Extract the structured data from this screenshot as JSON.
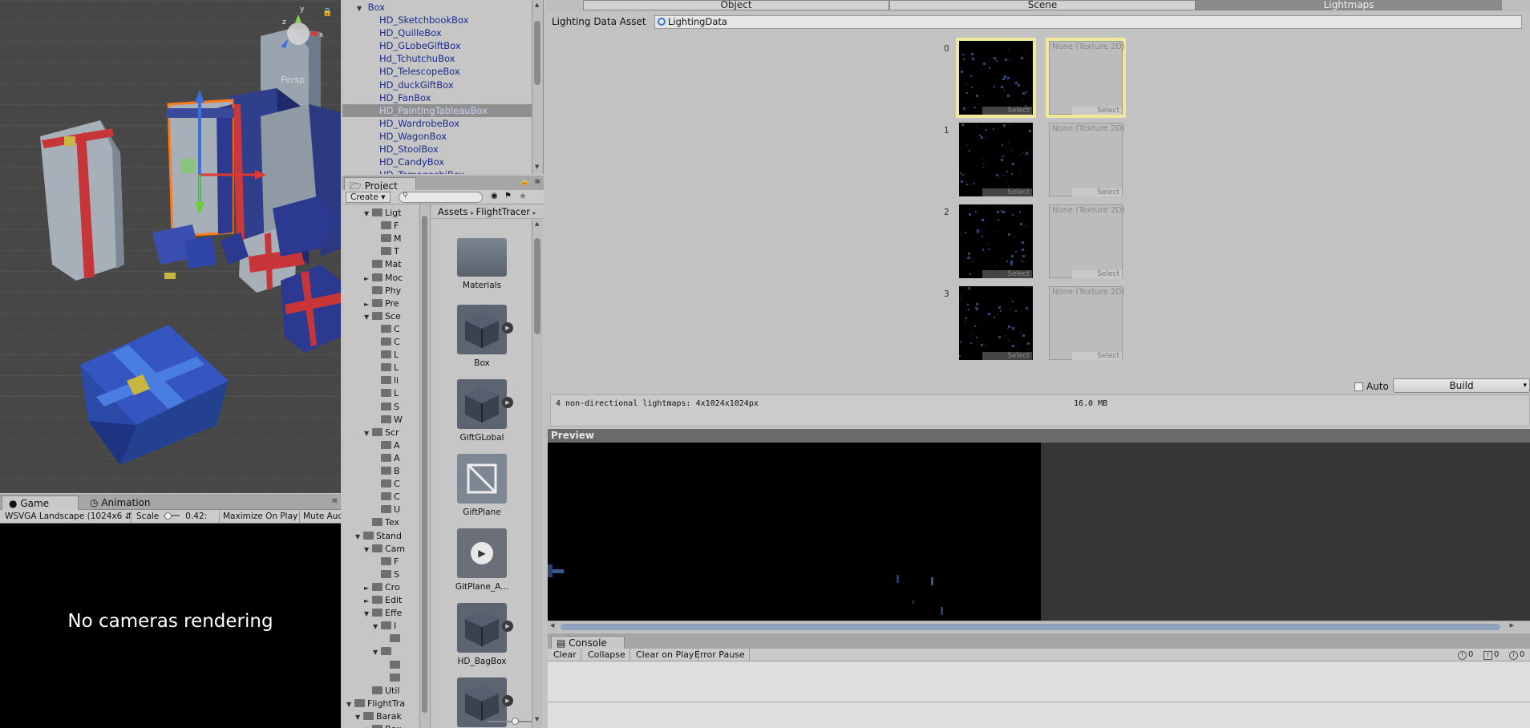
{
  "scene": {
    "persp_label": "Persp"
  },
  "game": {
    "tabs": [
      {
        "label": "Game",
        "icon": "game-icon"
      },
      {
        "label": "Animation",
        "icon": "clock-icon"
      }
    ],
    "aspect_select": "WSVGA Landscape (1024x6",
    "scale_label": "Scale",
    "scale_value": "0.42:",
    "maximize_on_play": "Maximize On Play",
    "mute_audio": "Mute Aud",
    "no_camera_text": "No cameras rendering"
  },
  "hierarchy": {
    "parent": "Box",
    "items": [
      "HD_SketchbookBox",
      "HD_QuilleBox",
      "HD_GLobeGiftBox",
      "Hd_TchutchuBox",
      "HD_TelescopeBox",
      "HD_duckGiftBox",
      "HD_FanBox",
      "HD_PaintingTableauBox",
      "HD_WardrobeBox",
      "HD_WagonBox",
      "HD_StoolBox",
      "HD_CandyBox",
      "HD_TamagochiBox"
    ],
    "selected_index": 7
  },
  "project": {
    "tab_label": "Project",
    "create_label": "Create",
    "breadcrumb": [
      "Assets",
      "FlightTracer"
    ],
    "tree": [
      {
        "label": "Ligt",
        "indent": 3,
        "arrow": "▼"
      },
      {
        "label": "F",
        "indent": 4,
        "arrow": ""
      },
      {
        "label": "M",
        "indent": 4,
        "arrow": ""
      },
      {
        "label": "T",
        "indent": 4,
        "arrow": ""
      },
      {
        "label": "Mat",
        "indent": 3,
        "arrow": ""
      },
      {
        "label": "Moc",
        "indent": 3,
        "arrow": "►"
      },
      {
        "label": "Phy",
        "indent": 3,
        "arrow": ""
      },
      {
        "label": "Pre",
        "indent": 3,
        "arrow": "►"
      },
      {
        "label": "Sce",
        "indent": 3,
        "arrow": "▼"
      },
      {
        "label": "C",
        "indent": 4,
        "arrow": ""
      },
      {
        "label": "C",
        "indent": 4,
        "arrow": ""
      },
      {
        "label": "L",
        "indent": 4,
        "arrow": ""
      },
      {
        "label": "L",
        "indent": 4,
        "arrow": ""
      },
      {
        "label": "li",
        "indent": 4,
        "arrow": ""
      },
      {
        "label": "L",
        "indent": 4,
        "arrow": ""
      },
      {
        "label": "S",
        "indent": 4,
        "arrow": ""
      },
      {
        "label": "W",
        "indent": 4,
        "arrow": ""
      },
      {
        "label": "Scr",
        "indent": 3,
        "arrow": "▼"
      },
      {
        "label": "A",
        "indent": 4,
        "arrow": ""
      },
      {
        "label": "A",
        "indent": 4,
        "arrow": ""
      },
      {
        "label": "B",
        "indent": 4,
        "arrow": ""
      },
      {
        "label": "C",
        "indent": 4,
        "arrow": ""
      },
      {
        "label": "C",
        "indent": 4,
        "arrow": ""
      },
      {
        "label": "U",
        "indent": 4,
        "arrow": ""
      },
      {
        "label": "Tex",
        "indent": 3,
        "arrow": ""
      },
      {
        "label": "Stand",
        "indent": 2,
        "arrow": "▼"
      },
      {
        "label": "Cam",
        "indent": 3,
        "arrow": "▼"
      },
      {
        "label": "F",
        "indent": 4,
        "arrow": ""
      },
      {
        "label": "S",
        "indent": 4,
        "arrow": ""
      },
      {
        "label": "Cro",
        "indent": 3,
        "arrow": "►"
      },
      {
        "label": "Edit",
        "indent": 3,
        "arrow": "►"
      },
      {
        "label": "Effe",
        "indent": 3,
        "arrow": "▼"
      },
      {
        "label": "I",
        "indent": 4,
        "arrow": "▼"
      },
      {
        "label": "",
        "indent": 5,
        "arrow": ""
      },
      {
        "label": "",
        "indent": 4,
        "arrow": "▼"
      },
      {
        "label": "",
        "indent": 5,
        "arrow": ""
      },
      {
        "label": "",
        "indent": 5,
        "arrow": ""
      },
      {
        "label": "Util",
        "indent": 3,
        "arrow": ""
      },
      {
        "label": "FlightTra",
        "indent": 1,
        "arrow": "▼"
      },
      {
        "label": "Barak",
        "indent": 2,
        "arrow": "▼"
      },
      {
        "label": "Box",
        "indent": 3,
        "arrow": "▼"
      }
    ],
    "assets": [
      {
        "name": "Materials",
        "kind": "folder"
      },
      {
        "name": "Box",
        "kind": "model"
      },
      {
        "name": "GiftGLobal",
        "kind": "model"
      },
      {
        "name": "GiftPlane",
        "kind": "mesh"
      },
      {
        "name": "GitPlane_A...",
        "kind": "anim"
      },
      {
        "name": "HD_BagBox",
        "kind": "model"
      },
      {
        "name": "",
        "kind": "model"
      }
    ]
  },
  "lightmaps": {
    "tabs": [
      "Object",
      "Scene",
      "Lightmaps"
    ],
    "active_tab": 2,
    "lighting_data_label": "Lighting Data Asset",
    "lighting_data_value": "LightingData",
    "slots": [
      {
        "index": "0",
        "select": "Select",
        "none_label": "None (Texture 2D)",
        "highlighted": true
      },
      {
        "index": "1",
        "select": "Select",
        "none_label": "None (Texture 2D)",
        "highlighted": false
      },
      {
        "index": "2",
        "select": "Select",
        "none_label": "None (Texture 2D)",
        "highlighted": false
      },
      {
        "index": "3",
        "select": "Select",
        "none_label": "None (Texture 2D)",
        "highlighted": false
      }
    ],
    "auto_label": "Auto",
    "auto_checked": false,
    "build_label": "Build",
    "stats_text": "4 non-directional lightmaps: 4x1024x1024px",
    "stats_size": "16.0 MB"
  },
  "preview": {
    "title": "Preview"
  },
  "console": {
    "tab_label": "Console",
    "buttons": [
      "Clear",
      "Collapse",
      "Clear on Play",
      "Error Pause"
    ],
    "counts": [
      "0",
      "0",
      "0"
    ]
  },
  "colors": {
    "accent_selection": "#8f8f8f",
    "hier_text": "#1a2b8c",
    "lightmap_highlight": "#f0e89a",
    "scrollbar_thumb": "#8fa2bd"
  }
}
